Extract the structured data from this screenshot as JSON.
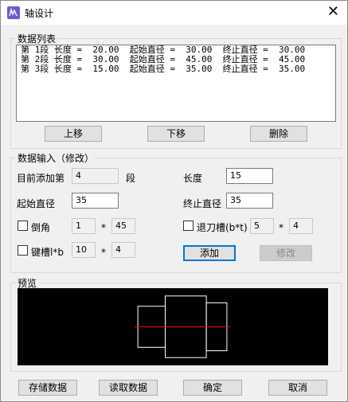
{
  "window": {
    "title": "轴设计",
    "close_glyph": "✕"
  },
  "list_group": {
    "legend": "数据列表",
    "rows": [
      "第 1段 长度 =  20.00  起始直径 =  30.00  终止直径 =  30.00",
      "第 2段 长度 =  30.00  起始直径 =  45.00  终止直径 =  45.00",
      "第 3段 长度 =  15.00  起始直径 =  35.00  终止直径 =  35.00"
    ],
    "buttons": {
      "up": "上移",
      "down": "下移",
      "delete": "删除"
    }
  },
  "input_group": {
    "legend": "数据输入（修改）",
    "current_add_label": "目前添加第",
    "current_add_value": "4",
    "segment_suffix": "段",
    "length_label": "长度",
    "length_value": "15",
    "start_dia_label": "起始直径",
    "start_dia_value": "35",
    "end_dia_label": "终止直径",
    "end_dia_value": "35",
    "chamfer_label": "倒角",
    "chamfer_a": "1",
    "chamfer_b": "45",
    "relief_label": "退刀槽(b*t)",
    "relief_b": "5",
    "relief_t": "4",
    "keyway_label": "键槽l*b",
    "keyway_l": "10",
    "keyway_b": "4",
    "times_sign": "*",
    "add_button": "添加",
    "modify_button": "修改"
  },
  "preview_group": {
    "legend": "预览",
    "segments": [
      {
        "length": 20,
        "diameter": 30
      },
      {
        "length": 30,
        "diameter": 45
      },
      {
        "length": 15,
        "diameter": 35
      }
    ],
    "outline_color": "#ffffff",
    "axis_color": "#ff0000",
    "background_color": "#000000"
  },
  "bottom_buttons": {
    "save": "存储数据",
    "load": "读取数据",
    "ok": "确定",
    "cancel": "取消"
  }
}
